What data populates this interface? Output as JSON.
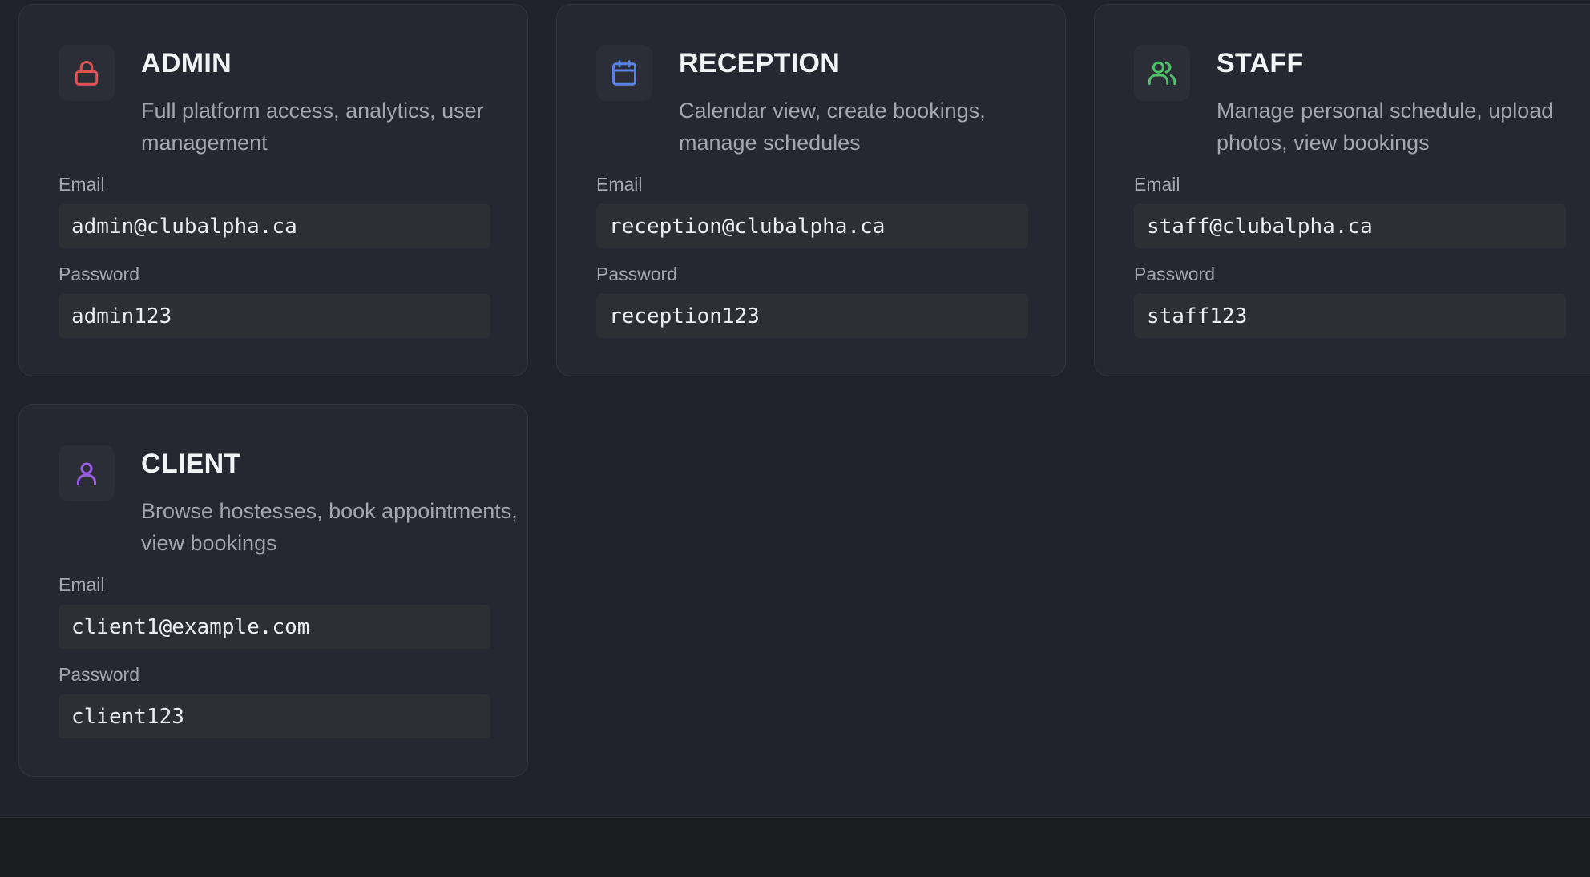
{
  "accounts": [
    {
      "role": "ADMIN",
      "description": "Full platform access, analytics, user management",
      "icon": "lock-icon",
      "icon_color": "#e05252",
      "email_label": "Email",
      "email": "admin@clubalpha.ca",
      "password_label": "Password",
      "password": "admin123"
    },
    {
      "role": "RECEPTION",
      "description": "Calendar view, create bookings, manage schedules",
      "icon": "calendar-icon",
      "icon_color": "#5b82e6",
      "email_label": "Email",
      "email": "reception@clubalpha.ca",
      "password_label": "Password",
      "password": "reception123"
    },
    {
      "role": "STAFF",
      "description": "Manage personal schedule, upload photos, view bookings",
      "icon": "users-icon",
      "icon_color": "#4fc26b",
      "email_label": "Email",
      "email": "staff@clubalpha.ca",
      "password_label": "Password",
      "password": "staff123"
    },
    {
      "role": "CLIENT",
      "description": "Browse hostesses, book appointments, view bookings",
      "icon": "user-icon",
      "icon_color": "#9b5de5",
      "email_label": "Email",
      "email": "client1@example.com",
      "password_label": "Password",
      "password": "client123"
    }
  ]
}
